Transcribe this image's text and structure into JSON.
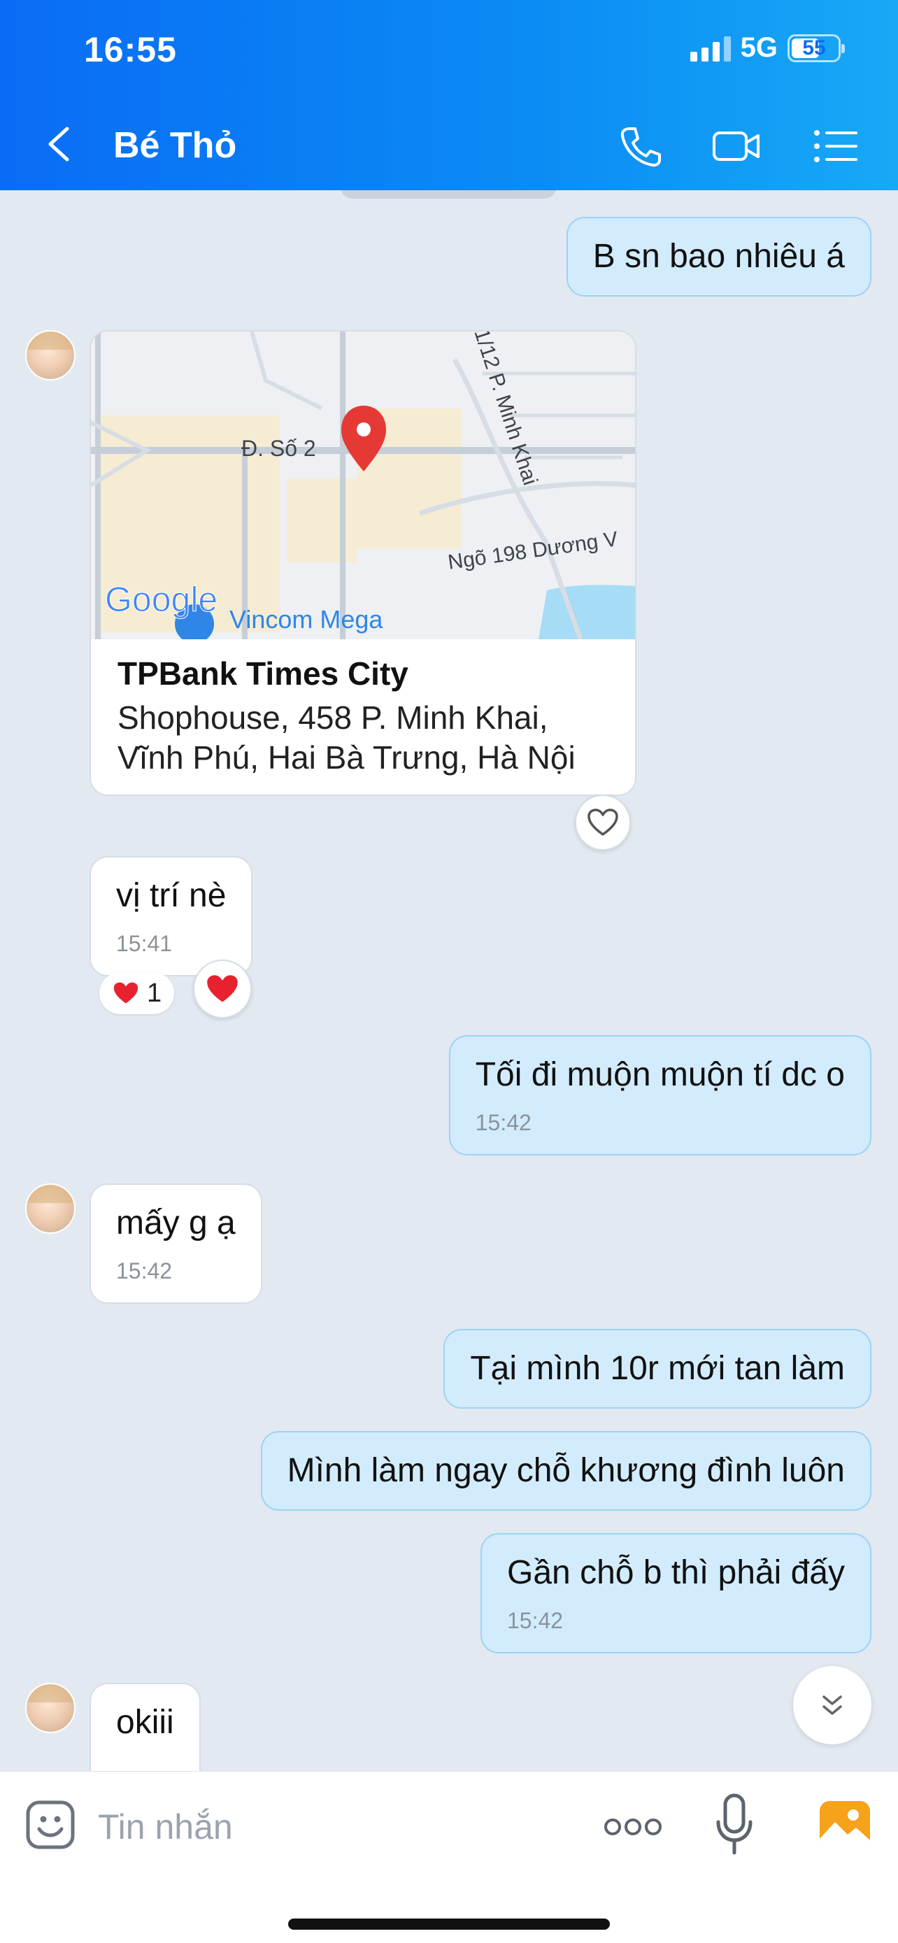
{
  "status_bar": {
    "time": "16:55",
    "network": "5G",
    "battery": "55"
  },
  "header": {
    "title": "Bé Thỏ"
  },
  "messages": {
    "m1": {
      "text": "B sn bao nhiêu á"
    },
    "location": {
      "name": "TPBank Times City",
      "address": "Shophouse, 458 P. Minh Khai, Vĩnh Phú, Hai Bà Trưng, Hà Nội",
      "map_labels": {
        "road1": "Đ. Số 2",
        "road2": "1/12 P. Minh Khai",
        "road3": "Ngõ 198 Dương V",
        "poi": "Vincom Mega",
        "logo": "Google"
      }
    },
    "m2": {
      "text": "vị trí nè",
      "time": "15:41",
      "reaction_count": "1"
    },
    "m3": {
      "text": "Tối đi muộn muộn tí dc o",
      "time": "15:42"
    },
    "m4": {
      "text": "mấy g ạ",
      "time": "15:42"
    },
    "m5": {
      "text": "Tại mình 10r mới tan làm"
    },
    "m6": {
      "text": "Mình làm ngay chỗ khương đình luôn"
    },
    "m7": {
      "text": "Gần chỗ b thì phải đấy",
      "time": "15:42"
    },
    "m8": {
      "text": "okiii"
    }
  },
  "composer": {
    "placeholder": "Tin nhắn"
  },
  "colors": {
    "header": "#0a6cf5",
    "outgoing_bubble": "#d2ecfd",
    "incoming_bubble": "#ffffff",
    "background": "#e2e9f1",
    "reaction": "#e8212f"
  }
}
